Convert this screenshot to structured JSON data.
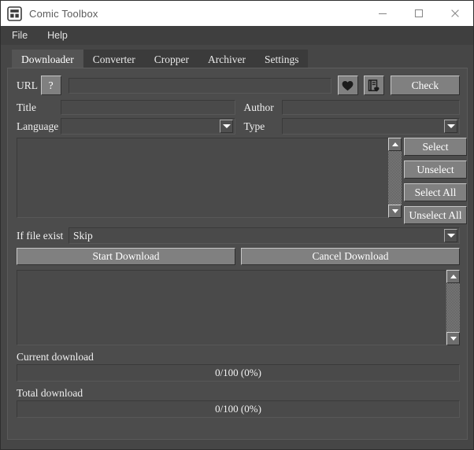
{
  "window": {
    "title": "Comic Toolbox",
    "icon": "app-grid-icon",
    "controls": {
      "minimize": "minimize-icon",
      "maximize": "maximize-icon",
      "close": "close-icon"
    }
  },
  "menubar": {
    "items": [
      {
        "label": "File"
      },
      {
        "label": "Help"
      }
    ]
  },
  "tabs": [
    {
      "label": "Downloader",
      "active": true
    },
    {
      "label": "Converter",
      "active": false
    },
    {
      "label": "Cropper",
      "active": false
    },
    {
      "label": "Archiver",
      "active": false
    },
    {
      "label": "Settings",
      "active": false
    }
  ],
  "downloader": {
    "url_row": {
      "label": "URL",
      "help_button": "?",
      "input_value": "",
      "input_placeholder": "",
      "favorite_icon": "heart-icon",
      "favorites_list_icon": "bookmark-heart-icon",
      "check_button": "Check"
    },
    "title_field": {
      "label": "Title",
      "value": "",
      "placeholder": ""
    },
    "author_field": {
      "label": "Author",
      "value": "",
      "placeholder": ""
    },
    "language_field": {
      "label": "Language",
      "value": ""
    },
    "type_field": {
      "label": "Type",
      "value": ""
    },
    "list": {
      "items": [],
      "buttons": [
        {
          "label": "Select"
        },
        {
          "label": "Unselect"
        },
        {
          "label": "Select All"
        },
        {
          "label": "Unselect All"
        }
      ]
    },
    "if_file_exist": {
      "label": "If file exist",
      "value": "Skip"
    },
    "start_button": "Start Download",
    "cancel_button": "Cancel Download",
    "log": {
      "text": ""
    },
    "current_download": {
      "label": "Current download",
      "value": "0/100 (0%)",
      "percent": 0
    },
    "total_download": {
      "label": "Total download",
      "value": "0/100 (0%)",
      "percent": 0
    }
  },
  "colors": {
    "window_bg": "#464646",
    "panel_bg": "#4c4c4c",
    "field_bg": "#4a4a4a",
    "button_face": "#808080",
    "titlebar_bg": "#ffffff",
    "text": "#f0f0f0"
  }
}
